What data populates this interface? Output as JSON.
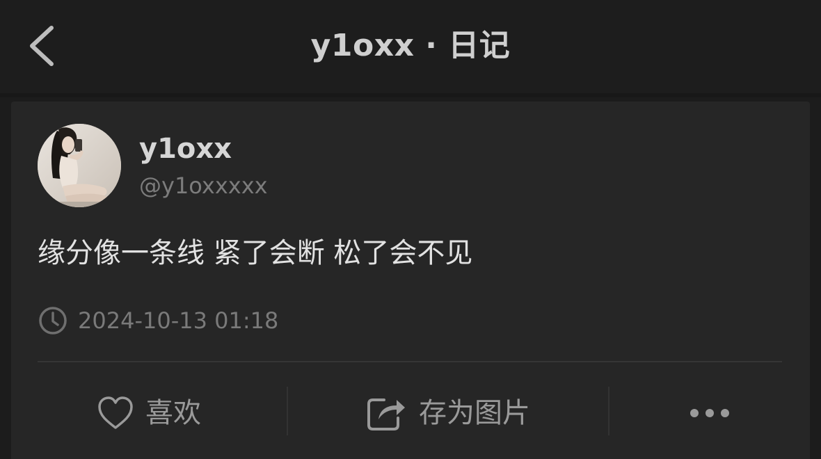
{
  "header": {
    "title": "y1oxx · 日记",
    "back_icon": "chevron-left-icon"
  },
  "post": {
    "author": {
      "name": "y1oxx",
      "handle": "@y1oxxxxx"
    },
    "text": "缘分像一条线 紧了会断 松了会不见",
    "timestamp": "2024-10-13 01:18"
  },
  "actions": {
    "like_label": "喜欢",
    "save_label": "存为图片",
    "like_icon": "heart-outline-icon",
    "save_icon": "share-export-icon",
    "more_icon": "more-dots-icon"
  },
  "colors": {
    "background": "#1c1c1c",
    "card": "#262626",
    "text_primary": "#e2e2e2",
    "text_secondary": "#7a7a7a"
  }
}
